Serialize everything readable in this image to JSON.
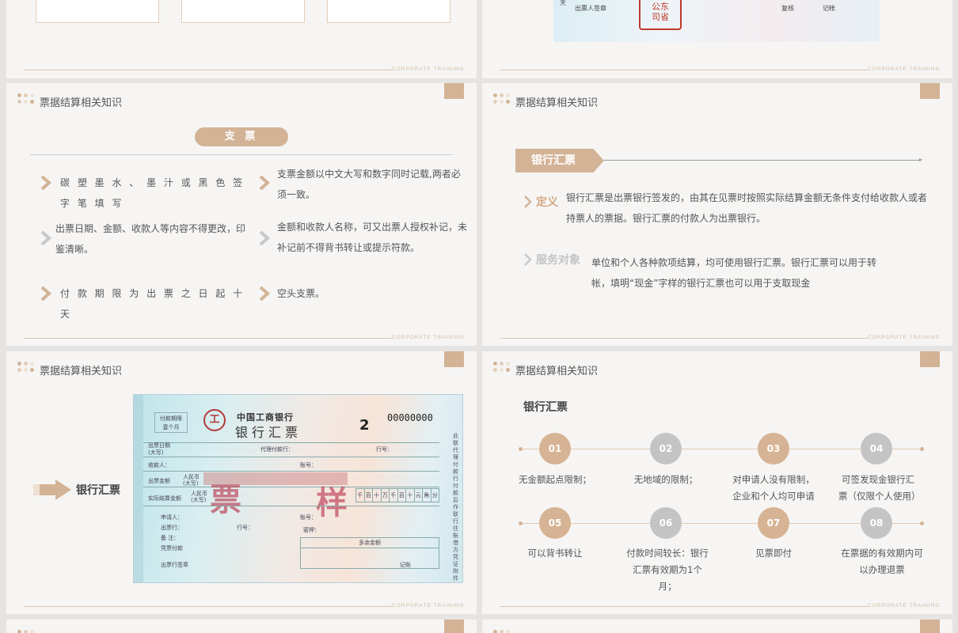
{
  "common": {
    "slide_title": "票据结算相关知识",
    "footer": "CORPORATE TRAINING"
  },
  "colors": {
    "accent": "#d3b396",
    "accent_dark": "#c9a37f",
    "gray": "#c4c4c4",
    "text": "#555555"
  },
  "top_right": {
    "labels": [
      "出票人签章",
      "复核",
      "记帐"
    ],
    "stamp_text": [
      "公东",
      "司省"
    ],
    "edge_char": "天"
  },
  "check_slide": {
    "header": "支 票",
    "left_items": [
      "碳 塑 墨 水 、 墨 汁 或 黑 色 签 字 笔 填 写",
      "出票日期、金额、收款人等内容不得更改，印鉴清晰。",
      "付 款 期 限 为 出 票 之 日 起 十 天"
    ],
    "right_items": [
      "支票金额以中文大写和数字同时记载,两者必须一致。",
      "金额和收款人名称，可又出票人授权补记，未补记前不得背书转让或提示符款。",
      "空头支票。"
    ]
  },
  "draft_def_slide": {
    "banner": "银行汇票",
    "definition_label": "定义",
    "definition_text": "银行汇票是出票银行签发的，由其在见票时按照实际结算金额无条件支付给收款人或者持票人的票据。银行汇票的付款人为出票银行。",
    "scope_label": "服务对象",
    "scope_text": "单位和个人各种款项结算，均可使用银行汇票。银行汇票可以用于转帐，填明“现金”字样的银行汇票也可以用于支取现金"
  },
  "draft_image_slide": {
    "arrow_label": "银行汇票",
    "bank_name": "中国工商银行",
    "doc_title": "银行汇票",
    "number_prefix": "2",
    "serial": "00000000",
    "watermark": [
      "票",
      "样"
    ],
    "form_labels": [
      "付款期限",
      "壹个月",
      "出票日期",
      "(大写)",
      "代理付款行：",
      "行号：",
      "收款人：",
      "账号：",
      "出票金额",
      "人民币",
      "(大写)",
      "实际结算金额",
      "人民币",
      "(大写)",
      "申请人：",
      "账号：",
      "出票行：",
      "行号：",
      "备 注：",
      "密押：",
      "凭票付款",
      "多余金额",
      "出票行签章",
      "记账"
    ],
    "amount_cols": [
      "千",
      "百",
      "十",
      "万",
      "千",
      "百",
      "十",
      "元",
      "角",
      "分"
    ],
    "side_text": "此联代理付款行付款后作联行往账借方凭证附件"
  },
  "features_slide": {
    "heading": "银行汇票",
    "items": [
      {
        "num": "01",
        "text": "无金额起点限制；"
      },
      {
        "num": "02",
        "text": "无地域的限制；"
      },
      {
        "num": "03",
        "text": "对申请人没有限制，企业和个人均可申请"
      },
      {
        "num": "04",
        "text": "可签发现金银行汇票（仅限个人使用）"
      },
      {
        "num": "05",
        "text": "可以背书转让"
      },
      {
        "num": "06",
        "text": "付款时间较长：银行汇票有效期为1个月；"
      },
      {
        "num": "07",
        "text": "见票即付"
      },
      {
        "num": "08",
        "text": "在票据的有效期内可以办理退票"
      }
    ]
  }
}
